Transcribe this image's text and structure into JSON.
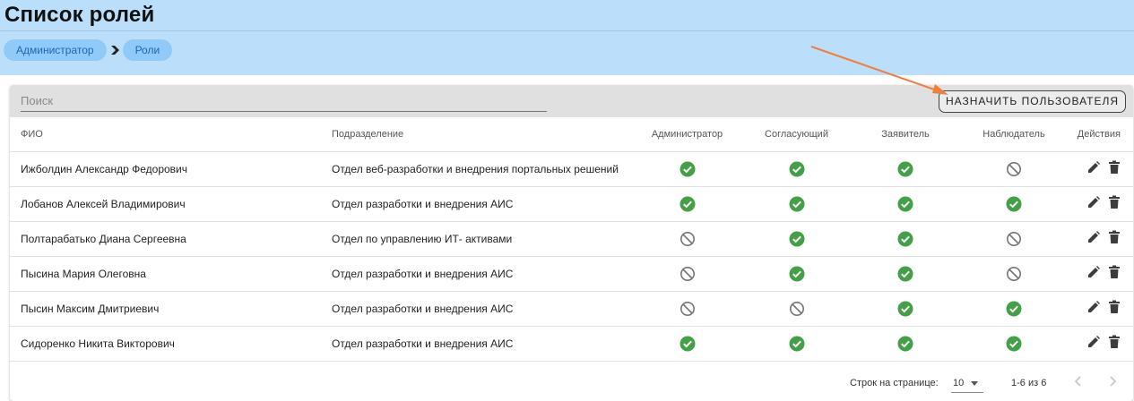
{
  "page": {
    "title": "Список ролей"
  },
  "breadcrumb": {
    "items": [
      "Администратор",
      "Роли"
    ]
  },
  "toolbar": {
    "search_placeholder": "Поиск",
    "assign_label": "НАЗНАЧИТЬ ПОЛЬЗОВАТЕЛЯ"
  },
  "table": {
    "headers": [
      "ФИО",
      "Подразделение",
      "Администратор",
      "Согласующий",
      "Заявитель",
      "Наблюдатель",
      "Действия"
    ],
    "rows": [
      {
        "name": "Ижболдин Александр Федорович",
        "dept": "Отдел веб-разработки и внедрения портальных решений",
        "roles": [
          true,
          true,
          true,
          false
        ]
      },
      {
        "name": "Лобанов Алексей Владимирович",
        "dept": "Отдел разработки и внедрения АИС",
        "roles": [
          true,
          true,
          true,
          true
        ]
      },
      {
        "name": "Полтарабатько Диана Сергеевна",
        "dept": "Отдел по управлению ИТ- активами",
        "roles": [
          false,
          true,
          true,
          false
        ]
      },
      {
        "name": "Пысина Мария Олеговна",
        "dept": "Отдел разработки и внедрения АИС",
        "roles": [
          false,
          true,
          true,
          false
        ]
      },
      {
        "name": "Пысин Максим Дмитриевич",
        "dept": "Отдел разработки и внедрения АИС",
        "roles": [
          false,
          false,
          true,
          true
        ]
      },
      {
        "name": "Сидоренко Никита Викторович",
        "dept": "Отдел разработки и внедрения АИС",
        "roles": [
          true,
          true,
          true,
          true
        ]
      }
    ]
  },
  "pagination": {
    "rows_per_page_label": "Строк на странице:",
    "rows_per_page": "10",
    "range": "1-6 из 6"
  },
  "icons": {
    "granted": "check-circle-icon",
    "denied": "block-icon",
    "edit": "pencil-icon",
    "delete": "trash-icon"
  },
  "colors": {
    "header_bg": "#bbdefb",
    "crumb_bg": "#90caf9",
    "crumb_text": "#1e66b0",
    "check": "#43a047",
    "arrow": "#f07e3c"
  }
}
